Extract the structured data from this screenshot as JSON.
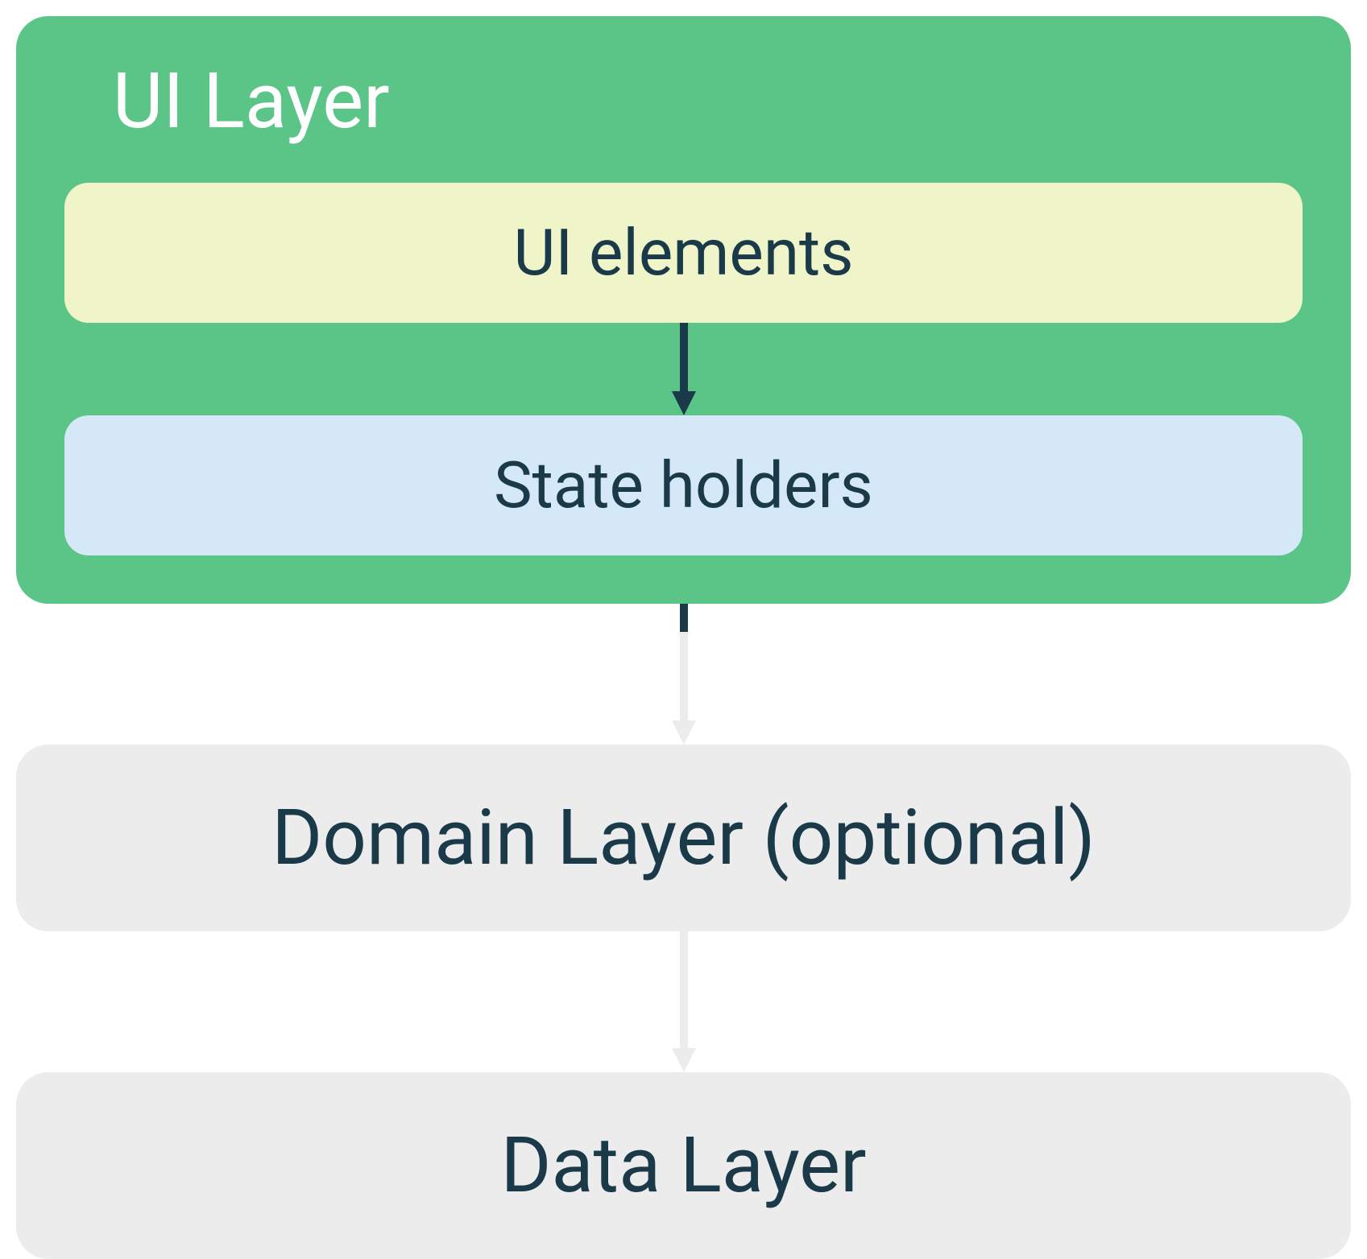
{
  "colors": {
    "ui_layer_bg": "#5bc587",
    "ui_elements_bg": "#f0f4c9",
    "state_holders_bg": "#d5e8f7",
    "layer_box_bg": "#ececec",
    "title_text": "#ffffff",
    "body_text": "#1a3a4a",
    "arrow_dark": "#1a3a4a",
    "arrow_light": "#ececec"
  },
  "ui_layer": {
    "title": "UI Layer",
    "ui_elements": "UI elements",
    "state_holders": "State holders"
  },
  "domain_layer": {
    "label": "Domain Layer (optional)"
  },
  "data_layer": {
    "label": "Data Layer"
  }
}
